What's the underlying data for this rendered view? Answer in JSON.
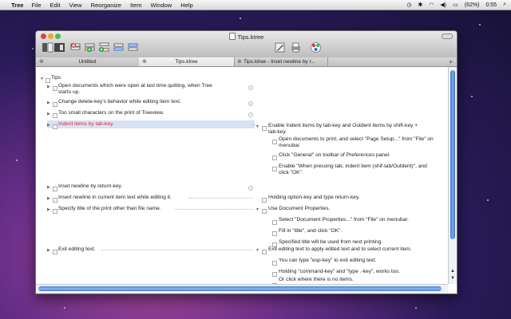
{
  "menubar": {
    "app": "Tree",
    "menus": [
      "File",
      "Edit",
      "View",
      "Reorganize",
      "Item",
      "Window",
      "Help"
    ],
    "battery": "(62%)",
    "clock": "0:55"
  },
  "window": {
    "title": "Tips.ktree",
    "tabs": [
      {
        "label": "Untitled"
      },
      {
        "label": "Tips.ktree"
      },
      {
        "label": "Tips.ktree - Inset newline by r..."
      }
    ]
  },
  "outline": {
    "root": "Tips",
    "left_items": [
      {
        "line1": "Open documents which were open at last time quitting, when Tree",
        "line2": "starts up."
      },
      {
        "line1": "Change delete-key's behavior while editing item text."
      },
      {
        "line1": "Too small characters on the print of Treeview."
      },
      {
        "line1": "Indent items by tab-key."
      },
      {
        "line1": "Inset newline by return-key."
      },
      {
        "line1": "Insert newline in current item text while editing it."
      },
      {
        "line1": "Specify title of the print other than file name."
      },
      {
        "line1": "Exit editing text."
      }
    ],
    "right_items": [
      {
        "line1": "Enable Indent items by tab-key and Outdent items by shift-key +",
        "line2": "tab-key."
      },
      {
        "line1": "Open documents to print, and select \"Page Setup...\" from \"File\" on",
        "line2": "menubar."
      },
      {
        "line1": "Click \"General\" on toolbar of Preferences panel."
      },
      {
        "line1": "Enable \"When pressing tab, indent item (shif-tab/Outdent)\", and",
        "line2": "click \"OK\"."
      },
      {
        "line1": "Holding option-key and type return-key."
      },
      {
        "line1": "Use Document Properties."
      },
      {
        "line1": "Select \"Document Properties...\" from \"File\" on menubar."
      },
      {
        "line1": "Fill in \"title\", and click \"OK\"."
      },
      {
        "line1": "Specified title will be used from next printing."
      },
      {
        "line1": "Exit editing text to apply edited text and to select current item."
      },
      {
        "line1": "You can type \"esp-key\" to exit editing text."
      },
      {
        "line1": "Holding \"command-key\" and \"type .-key\", works too."
      },
      {
        "line1": "Or click where there is no items."
      }
    ]
  },
  "colors": {
    "selection": "#d8e2f5",
    "selected_text": "#d12f2f",
    "scroll_thumb": "#3c73c9"
  }
}
